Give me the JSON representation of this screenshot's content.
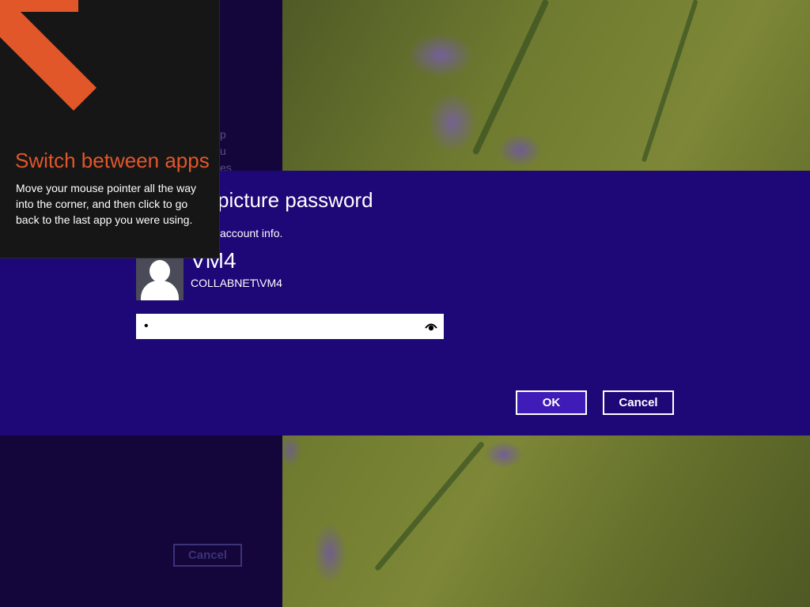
{
  "background_cancel_label": "Cancel",
  "faint_lines": [
    "p",
    "u",
    "es"
  ],
  "dialog": {
    "title": "picture password",
    "subtitle": "account info.",
    "user_name": "VM4",
    "user_domain": "COLLABNET\\VM4",
    "password_value": "•",
    "ok_label": "OK",
    "cancel_label": "Cancel"
  },
  "tip": {
    "title": "Switch between apps",
    "body": "Move your mouse pointer all the way into the corner, and then click to go back to the last app you were using."
  },
  "colors": {
    "dialog_bg": "#1e0776",
    "ok_button_bg": "#3f1bb8",
    "tip_accent": "#e2572a",
    "tip_bg": "#161616"
  },
  "icons": [
    "corner-arrow-icon",
    "user-avatar-icon",
    "reveal-password-icon"
  ]
}
